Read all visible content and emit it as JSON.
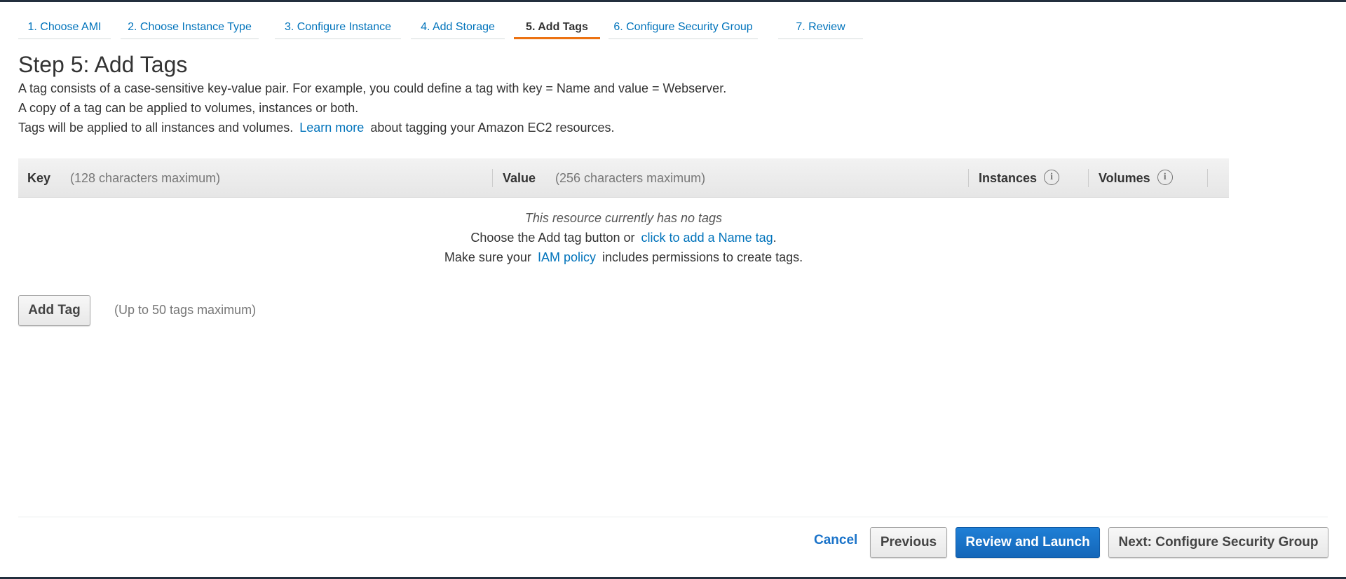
{
  "wizard": {
    "steps": [
      {
        "label": "1. Choose AMI",
        "active": false
      },
      {
        "label": "2. Choose Instance Type",
        "active": false
      },
      {
        "label": "3. Configure Instance",
        "active": false
      },
      {
        "label": "4. Add Storage",
        "active": false
      },
      {
        "label": "5. Add Tags",
        "active": true
      },
      {
        "label": "6. Configure Security Group",
        "active": false
      },
      {
        "label": "7. Review",
        "active": false
      }
    ]
  },
  "page": {
    "title": "Step 5: Add Tags",
    "desc_line1": "A tag consists of a case-sensitive key-value pair. For example, you could define a tag with key = Name and value = Webserver.",
    "desc_line2": "A copy of a tag can be applied to volumes, instances or both.",
    "desc_line3_pre": "Tags will be applied to all instances and volumes.",
    "desc_line3_link": "Learn more",
    "desc_line3_post": "about tagging your Amazon EC2 resources."
  },
  "table": {
    "key_header": "Key",
    "key_hint": "(128 characters maximum)",
    "value_header": "Value",
    "value_hint": "(256 characters maximum)",
    "instances_header": "Instances",
    "volumes_header": "Volumes",
    "info_glyph": "i",
    "empty_title": "This resource currently has no tags",
    "empty_line2_pre": "Choose the Add tag button or",
    "empty_line2_link": "click to add a Name tag",
    "empty_line2_post": ".",
    "empty_line3_pre": "Make sure your",
    "empty_line3_link": "IAM policy",
    "empty_line3_post": "includes permissions to create tags."
  },
  "actions": {
    "add_tag_label": "Add Tag",
    "add_tag_limit": "(Up to 50 tags maximum)",
    "cancel_label": "Cancel",
    "previous_label": "Previous",
    "review_launch_label": "Review and Launch",
    "next_label": "Next: Configure Security Group"
  },
  "colors": {
    "link": "#0073bb",
    "active_step_underline": "#ec7211",
    "primary_button": "#1a6fc6",
    "top_bar": "#232f3e"
  }
}
